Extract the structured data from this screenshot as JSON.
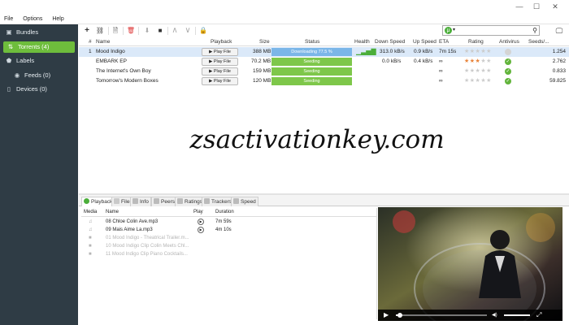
{
  "window": {
    "minimize": "—",
    "maximize": "☐",
    "close": "✕"
  },
  "menu": [
    "File",
    "Options",
    "Help"
  ],
  "sidebar": {
    "items": [
      {
        "label": "Bundles",
        "icon": "bundles-icon",
        "glyph": "▣"
      },
      {
        "label": "Torrents (4)",
        "icon": "torrents-icon",
        "glyph": "⇅"
      },
      {
        "label": "Labels",
        "icon": "label-icon",
        "glyph": "⬟"
      },
      {
        "label": "Feeds (0)",
        "icon": "feed-icon",
        "glyph": "◉"
      },
      {
        "label": "Devices (0)",
        "icon": "device-icon",
        "glyph": "▯"
      }
    ]
  },
  "toolbar": {
    "add": "+",
    "link": "⛓",
    "create": "🗎",
    "remove": "🗑",
    "start": "⬇",
    "stop": "■",
    "up": "∧",
    "down": "∨",
    "unlock": "🔒",
    "search_brand": "μ",
    "search_icon": "⚲",
    "remote": "🖵"
  },
  "columns": [
    "#",
    "Name",
    "Playback",
    "Size",
    "Status",
    "Health",
    "Down Speed",
    "Up Speed",
    "ETA",
    "Rating",
    "Antivirus",
    "Seeds/..."
  ],
  "torrents": [
    {
      "num": "1",
      "name": "Mood Indigo",
      "play": "▶ Play File",
      "size": "388 MB",
      "status": "Downloading 77.5 %",
      "health": "▁▃▅▇",
      "down": "313.0 kB/s",
      "up": "0.9 kB/s",
      "eta": "7m 15s",
      "rating_on": "",
      "rating_off": "★★★★★",
      "av": "",
      "seeds": "1.254"
    },
    {
      "num": "",
      "name": "EMBARK EP",
      "play": "▶ Play File",
      "size": "70.2 MB",
      "status": "Seeding",
      "health": "",
      "down": "0.0 kB/s",
      "up": "0.4 kB/s",
      "eta": "∞",
      "rating_on": "★★★",
      "rating_off": "★★",
      "av": "✓",
      "seeds": "2.762"
    },
    {
      "num": "",
      "name": "The Internet's Own Boy",
      "play": "▶ Play File",
      "size": "159 MB",
      "status": "Seeding",
      "health": "",
      "down": "",
      "up": "",
      "eta": "∞",
      "rating_on": "",
      "rating_off": "★★★★★",
      "av": "✓",
      "seeds": "0.833"
    },
    {
      "num": "",
      "name": "Tomorrow's Modern Boxes",
      "play": "▶ Play File",
      "size": "120 MB",
      "status": "Seeding",
      "health": "",
      "down": "",
      "up": "",
      "eta": "∞",
      "rating_on": "",
      "rating_off": "★★★★★",
      "av": "✓",
      "seeds": "59.825"
    }
  ],
  "watermark": "zsactivationkey.com",
  "detail_tabs": [
    "Playback",
    "Files",
    "Info",
    "Peers",
    "Ratings",
    "Trackers",
    "Speed"
  ],
  "files": {
    "headers": [
      "Media",
      "Name",
      "Play",
      "Duration"
    ],
    "rows": [
      {
        "media": "♫",
        "name": "08 Chloe Colin Ave.mp3",
        "play": "▶",
        "duration": "7m 59s"
      },
      {
        "media": "♫",
        "name": "09 Mais Aime La.mp3",
        "play": "▶",
        "duration": "4m 10s"
      },
      {
        "media": "■",
        "name": "01 Mood Indigo - Theatrical Trailer.m...",
        "play": "",
        "duration": ""
      },
      {
        "media": "■",
        "name": "10 Mood Indigo Clip Colin Meets Chl...",
        "play": "",
        "duration": ""
      },
      {
        "media": "■",
        "name": "11 Mood Indigo Clip Piano Cocktails...",
        "play": "",
        "duration": ""
      }
    ]
  },
  "video": {
    "play": "▶",
    "volume": "◀)",
    "fullscreen": "⤢"
  },
  "colors": {
    "accent": "#6ebd3c",
    "sidebar": "#2f3c45",
    "download": "#7bb6e8",
    "seeding": "#7ec74a"
  }
}
